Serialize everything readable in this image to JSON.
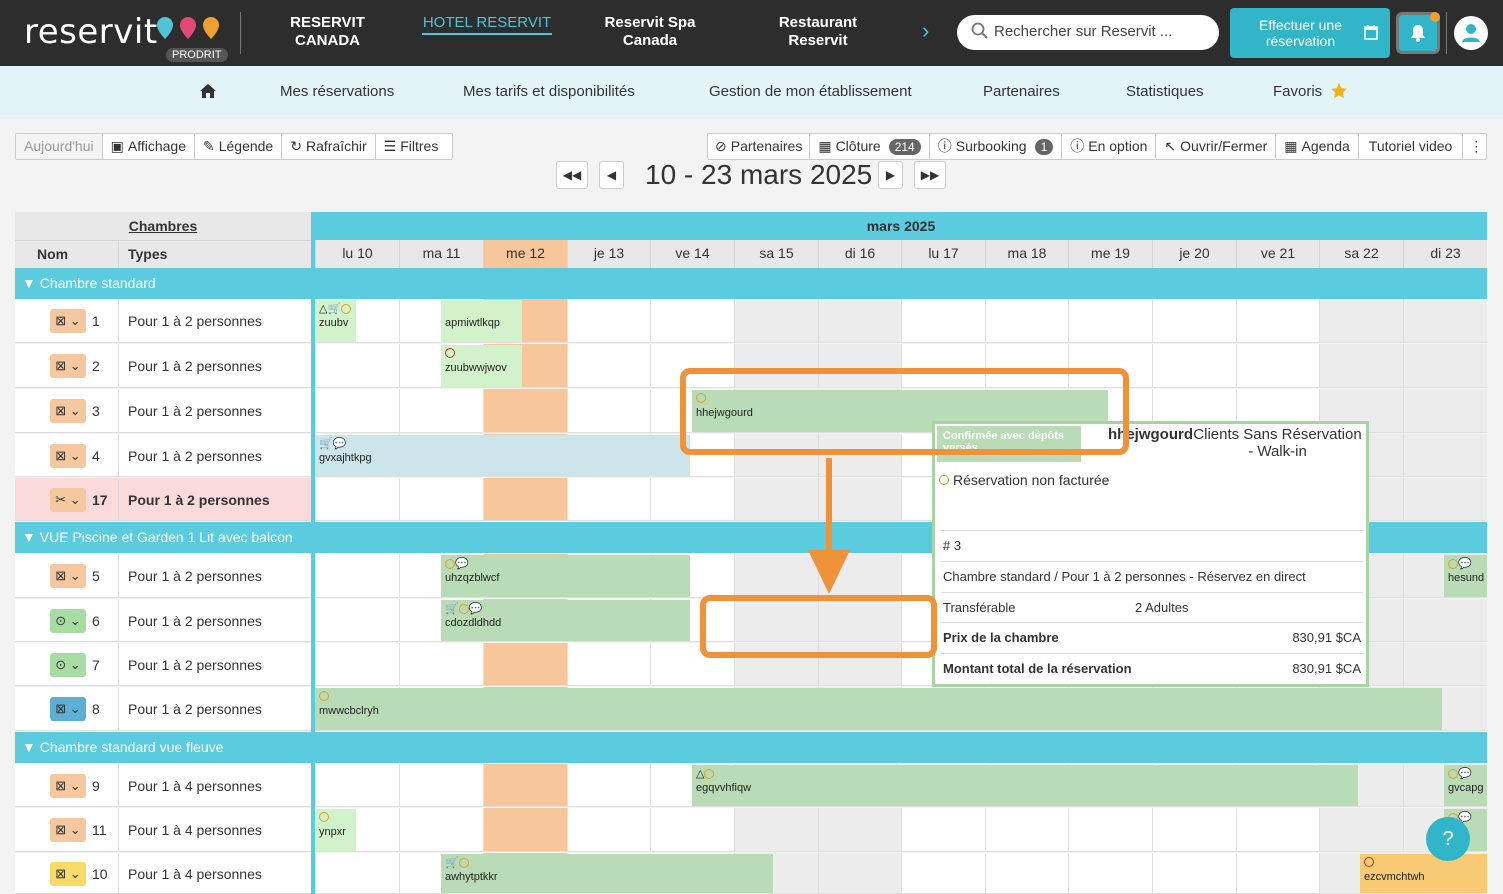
{
  "brand": {
    "logo": "reservit",
    "badge": "PRODRIT"
  },
  "properties": [
    {
      "label": "RESERVIT CANADA",
      "active": false
    },
    {
      "label": "HOTEL RESERVIT",
      "active": true
    },
    {
      "label": "Reservit Spa Canada",
      "active": false
    },
    {
      "label": "Restaurant Reservit",
      "active": false
    }
  ],
  "search": {
    "placeholder": "Rechercher sur Reservit ..."
  },
  "reserve_button": "Effectuer une réservation",
  "nav": [
    "Mes réservations",
    "Mes tarifs et disponibilités",
    "Gestion de mon établissement",
    "Partenaires",
    "Statistiques",
    "Favoris"
  ],
  "toolbar_left": [
    "Aujourd'hui",
    "Affichage",
    "Légende",
    "Rafraîchir",
    "Filtres"
  ],
  "toolbar_right": {
    "partenaires": "Partenaires",
    "cloture": "Clôture",
    "cloture_count": "214",
    "surbooking": "Surbooking",
    "surbooking_count": "1",
    "en_option": "En option",
    "ouvrir": "Ouvrir/Fermer",
    "agenda": "Agenda",
    "tutoriel": "Tutoriel video"
  },
  "date_range": "10 - 23 mars 2025",
  "grid": {
    "chambres_label": "Chambres",
    "col_nom": "Nom",
    "col_types": "Types",
    "month": "mars 2025",
    "days": [
      "lu 10",
      "ma 11",
      "me 12",
      "je 13",
      "ve 14",
      "sa 15",
      "di 16",
      "lu 17",
      "ma 18",
      "me 19",
      "je 20",
      "ve 21",
      "sa 22",
      "di 23"
    ]
  },
  "groups": [
    {
      "label": "Chambre standard"
    },
    {
      "label": "VUE Piscine et Garden 1 Lit avec balcon"
    },
    {
      "label": "Chambre standard vue fleuve"
    }
  ],
  "rooms": [
    {
      "num": "1",
      "type": "Pour 1 à 2 personnes",
      "status": "orange"
    },
    {
      "num": "2",
      "type": "Pour 1 à 2 personnes",
      "status": "orange"
    },
    {
      "num": "3",
      "type": "Pour 1 à 2 personnes",
      "status": "orange"
    },
    {
      "num": "4",
      "type": "Pour 1 à 2 personnes",
      "status": "orange"
    },
    {
      "num": "17",
      "type": "Pour 1 à 2 personnes",
      "status": "orange-tools"
    },
    {
      "num": "5",
      "type": "Pour 1 à 2 personnes",
      "status": "orange"
    },
    {
      "num": "6",
      "type": "Pour 1 à 2 personnes",
      "status": "green"
    },
    {
      "num": "7",
      "type": "Pour 1 à 2 personnes",
      "status": "green"
    },
    {
      "num": "8",
      "type": "Pour 1 à 2 personnes",
      "status": "blue"
    },
    {
      "num": "9",
      "type": "Pour 1 à 4 personnes",
      "status": "orange"
    },
    {
      "num": "11",
      "type": "Pour 1 à 4 personnes",
      "status": "orange"
    },
    {
      "num": "10",
      "type": "Pour 1 à 4 personnes",
      "status": "yellow"
    }
  ],
  "reservations": [
    {
      "name": "zuubv"
    },
    {
      "name": "apmiwtlkqp"
    },
    {
      "name": "zuubwwjwov"
    },
    {
      "name": "hhejwgourd"
    },
    {
      "name": "gvxajhtkpg"
    },
    {
      "name": "uhzqzblwcf"
    },
    {
      "name": "cdozdldhdd"
    },
    {
      "name": "mwwcbclryh"
    },
    {
      "name": "egqvvhfiqw"
    },
    {
      "name": "ynpxr"
    },
    {
      "name": "awhytptkkr"
    },
    {
      "name": "ezcvmchtwh"
    },
    {
      "name": "hesund"
    },
    {
      "name": "gvcapg"
    },
    {
      "name": "apg"
    }
  ],
  "tooltip": {
    "status": "Confirmée avec dépôts versés",
    "name": "hhejwgourd",
    "client": "Clients Sans Réservation - Walk-in",
    "non_facturee": "Réservation non facturée",
    "number": "# 3",
    "room_desc": "Chambre standard / Pour 1 à 2 personnes - Réservez en direct",
    "transferable": "Transférable",
    "guests": "2 Adultes",
    "prix_label": "Prix de la chambre",
    "prix_value": "830,91 $CA",
    "total_label": "Montant total de la réservation",
    "total_value": "830,91 $CA"
  },
  "help_label": "?",
  "colors": {
    "accent": "#31b6c9",
    "header_bg": "#2d2d2d",
    "annotation": "#f0923a",
    "resa_green": "#b9dcb6",
    "today": "#f7c79b"
  }
}
